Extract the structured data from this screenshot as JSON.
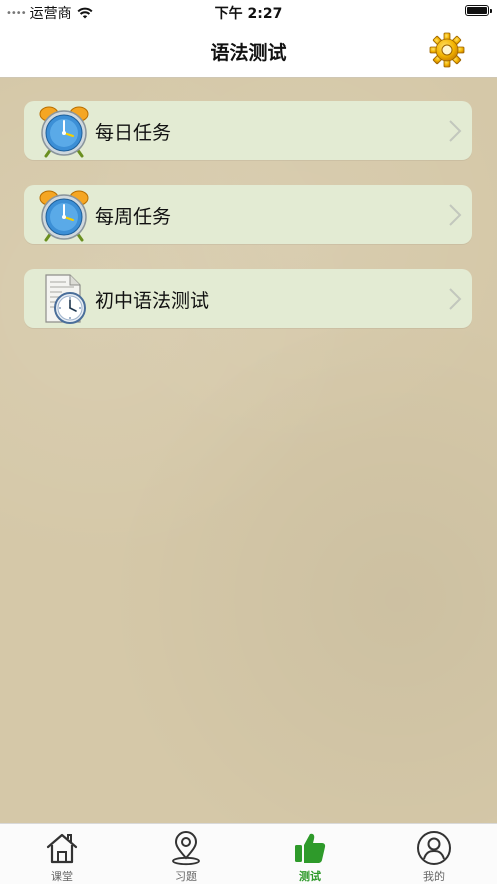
{
  "status_bar": {
    "signal": "••••",
    "carrier": "运营商",
    "time": "下午 2:27"
  },
  "header": {
    "title": "语法测试",
    "settings_icon": "gear-icon"
  },
  "menu": {
    "items": [
      {
        "label": "每日任务",
        "icon": "alarm-clock-icon"
      },
      {
        "label": "每周任务",
        "icon": "alarm-clock-icon"
      },
      {
        "label": "初中语法测试",
        "icon": "document-clock-icon"
      }
    ]
  },
  "tab_bar": {
    "active_color": "#2e9a2a",
    "tabs": [
      {
        "label": "课堂",
        "icon": "home-icon"
      },
      {
        "label": "习题",
        "icon": "location-pin-icon"
      },
      {
        "label": "测试",
        "icon": "thumbs-up-icon",
        "active": true
      },
      {
        "label": "我的",
        "icon": "user-icon"
      }
    ]
  }
}
